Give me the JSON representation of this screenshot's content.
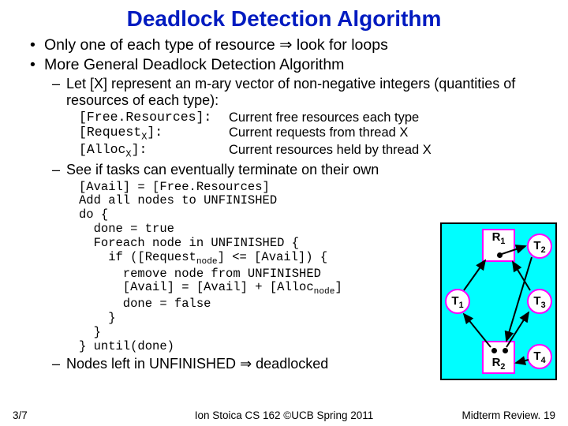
{
  "title": "Deadlock Detection Algorithm",
  "b1": "Only one of each type of resource ",
  "b1_after": " look for loops",
  "b2": "More General Deadlock Detection Algorithm",
  "s1": "Let [X] represent an m-ary vector of non-negative integers (quantities of resources of each type):",
  "defs": [
    {
      "term_pre": "[Free.Resources]:",
      "term_sub": "",
      "term_post": "",
      "desc": "Current free resources each type"
    },
    {
      "term_pre": "[Request",
      "term_sub": "X",
      "term_post": "]:",
      "desc": "Current requests from thread X"
    },
    {
      "term_pre": "[Alloc",
      "term_sub": "X",
      "term_post": "]:",
      "desc": "Current resources held by thread X"
    }
  ],
  "s2": "See if tasks can eventually terminate on their own",
  "code_l1": "[Avail] = [Free.Resources]",
  "code_l2": "Add all nodes to UNFINISHED",
  "code_l3": "do {",
  "code_l4": "  done = true",
  "code_l5": "  Foreach node in UNFINISHED {",
  "code_l6a": "    if ([Request",
  "code_l6b": "] <= [Avail]) {",
  "code_l7": "      remove node from UNFINISHED",
  "code_l8a": "      [Avail] = [Avail] + [Alloc",
  "code_l8b": "]",
  "code_l9": "      done = false",
  "code_l10": "    }",
  "code_l11": "  }",
  "code_l12": "} until(done)",
  "code_sub": "node",
  "s3_pre": "Nodes left in UNFINISHED ",
  "s3_post": " deadlocked",
  "arrow_glyph": "⇒",
  "diagram": {
    "R1_pre": "R",
    "R1_sub": "1",
    "R2_pre": "R",
    "R2_sub": "2",
    "T1": "T",
    "T1_sub": "1",
    "T2": "T",
    "T2_sub": "2",
    "T3": "T",
    "T3_sub": "3",
    "T4": "T",
    "T4_sub": "4"
  },
  "footer": {
    "left": "3/7",
    "center": "Ion Stoica CS 162 ©UCB Spring 2011",
    "right": "Midterm Review. 19"
  }
}
